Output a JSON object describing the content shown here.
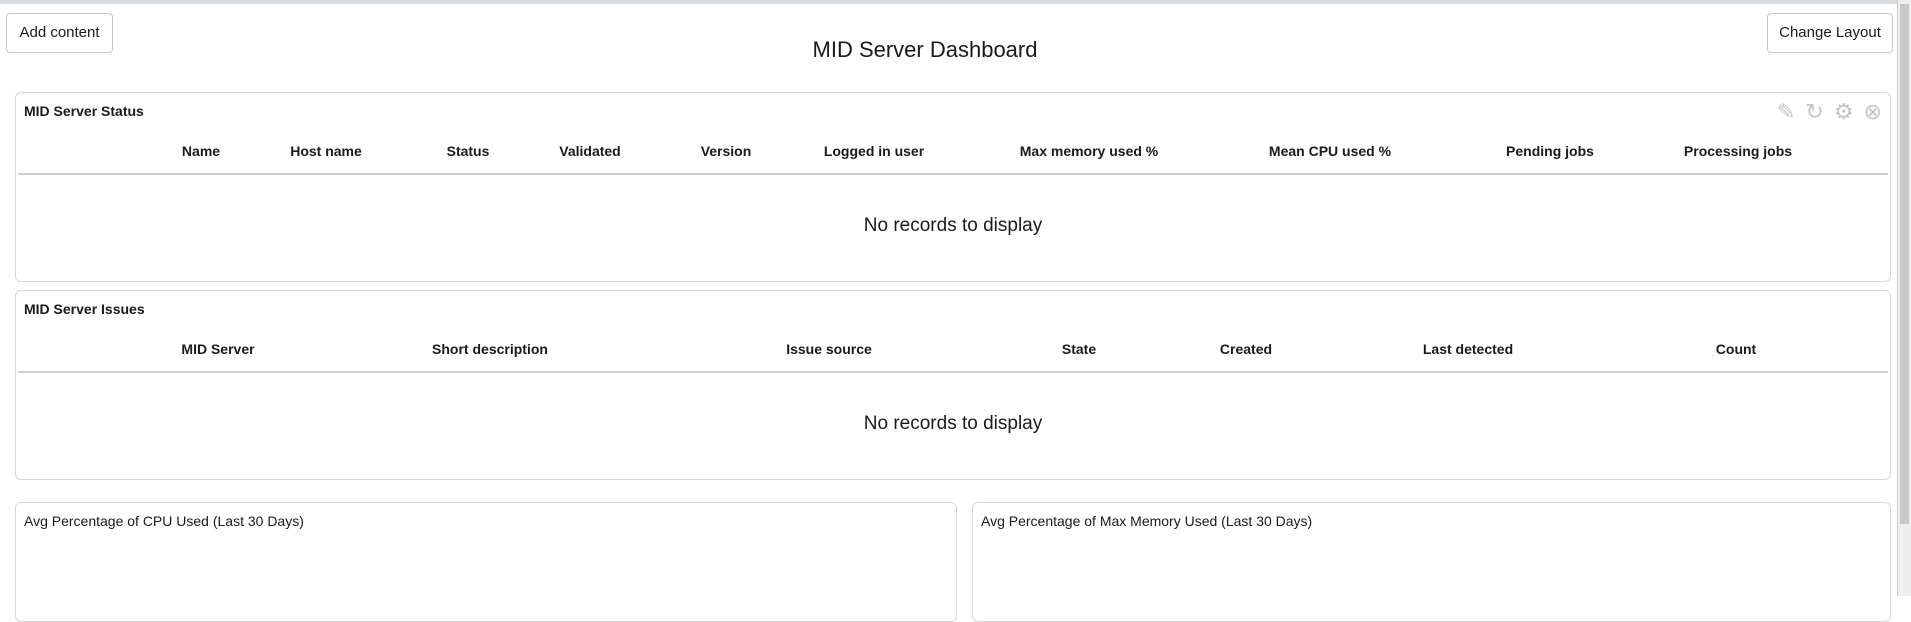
{
  "header": {
    "title": "MID Server Dashboard",
    "add_content": "Add content",
    "change_layout": "Change Layout"
  },
  "status_panel": {
    "title": "MID Server Status",
    "columns": [
      "Name",
      "Host name",
      "Status",
      "Validated",
      "Version",
      "Logged in user",
      "Max memory used %",
      "Mean CPU used %",
      "Pending jobs",
      "Processing jobs"
    ],
    "empty": "No records to display",
    "icons": [
      "pencil-icon",
      "refresh-icon",
      "gear-icon",
      "close-icon"
    ]
  },
  "issues_panel": {
    "title": "MID Server Issues",
    "columns": [
      "MID Server",
      "Short description",
      "Issue source",
      "State",
      "Created",
      "Last detected",
      "Count"
    ],
    "empty": "No records to display"
  },
  "cpu_panel": {
    "title": "Avg Percentage of CPU Used (Last 30 Days)"
  },
  "memory_panel": {
    "title": "Avg Percentage of Max Memory Used (Last 30 Days)"
  }
}
